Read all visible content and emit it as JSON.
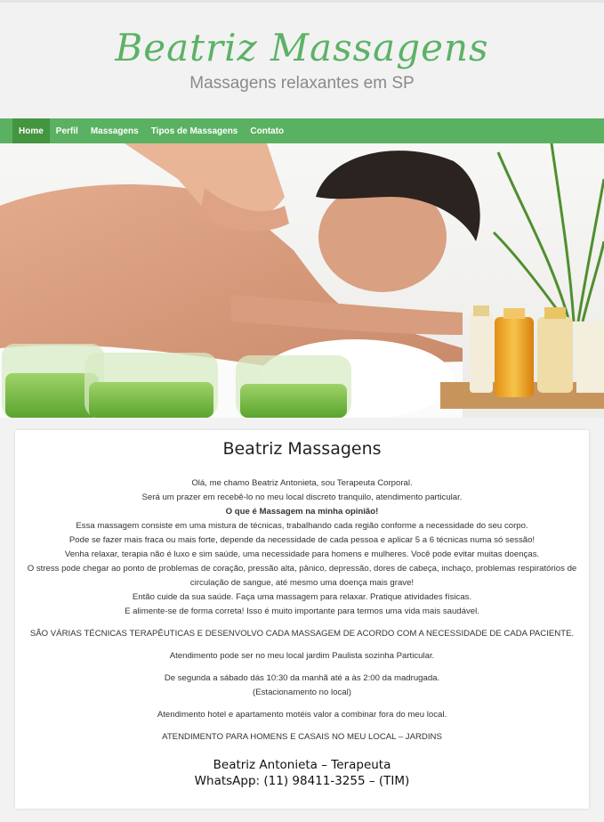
{
  "site": {
    "logo": "Beatriz  Massagens",
    "tagline": "Massagens relaxantes em SP"
  },
  "nav": {
    "items": [
      "Home",
      "Perfil",
      "Massagens",
      "Tipos de Massagens",
      "Contato"
    ],
    "active": "Home"
  },
  "colors": {
    "accent": "#5ab161",
    "active_tab": "#43953f",
    "logo": "#5cb266"
  },
  "hero": {
    "image": "man-receiving-back-massage-photo"
  },
  "content": {
    "title": "Beatriz Massagens",
    "p1": "Olá, me chamo Beatriz Antonieta, sou Terapeuta Corporal.",
    "p2": "Será um prazer em recebê-lo no meu local discreto tranquilo, atendimento particular.",
    "p3": "O que é Massagem na minha opinião!",
    "p4": "Essa massagem consiste em uma mistura de técnicas, trabalhando cada região conforme a necessidade do seu corpo.",
    "p5": "Pode se fazer mais fraca ou mais forte, depende da necessidade de cada pessoa e aplicar 5 a 6 técnicas numa só sessão!",
    "p6": "Venha relaxar, terapia não é luxo e sim saúde, uma necessidade para homens e mulheres. Você pode evitar muitas doenças.",
    "p7": "O stress pode chegar ao ponto de problemas de coração, pressão alta, pânico, depressão, dores de cabeça, inchaço, problemas respiratórios de",
    "p8": "circulação de sangue, até mesmo uma doença mais grave!",
    "p9": "Então cuide da sua saúde. Faça uma massagem para relaxar. Pratique atividades físicas.",
    "p10": "E alimente-se de forma correta! Isso é muito importante para termos uma vida mais saudável.",
    "p11": "SÃO VÁRIAS TÉCNICAS TERAPÊUTICAS E DESENVOLVO CADA MASSAGEM DE ACORDO COM A NECESSIDADE DE CADA PACIENTE.",
    "p12": "Atendimento pode ser no meu local jardim Paulista sozinha Particular.",
    "p13": "De segunda a sábado dás 10:30 da manhã até a às 2:00 da madrugada.",
    "p14": "(Estacionamento no local)",
    "p15": "Atendimento hotel e apartamento motéis valor a combinar fora do meu local.",
    "p16": "ATENDIMENTO PARA HOMENS E CASAIS NO MEU LOCAL – JARDINS",
    "sig_name": "Beatriz Antonieta – Terapeuta",
    "sig_whatsapp": "WhatsApp: (11) 98411-3255 – (TIM)"
  }
}
